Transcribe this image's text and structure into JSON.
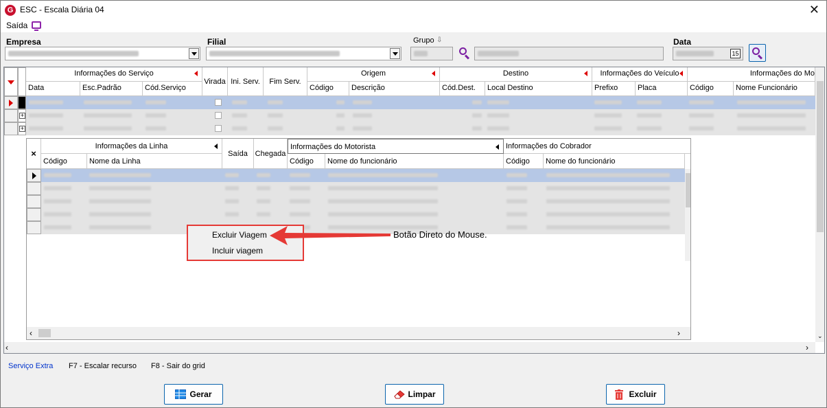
{
  "window": {
    "title": "ESC - Escala Diária 04",
    "logo_letter": "G"
  },
  "menu": {
    "saida": "Saída"
  },
  "filters": {
    "empresa_label": "Empresa",
    "filial_label": "Filial",
    "grupo_label": "Grupo",
    "grupo_sort_icon": "⇩",
    "data_label": "Data",
    "calendar_badge": "15"
  },
  "main_grid": {
    "group_headers": [
      "Informações do Serviço",
      "Virada",
      "Ini. Serv.",
      "Fim Serv.",
      "Origem",
      "Destino",
      "Informações do Veículo",
      "Informações do Mo"
    ],
    "columns": [
      "Data",
      "Esc.Padrão",
      "Cód.Serviço",
      "Código",
      "Descrição",
      "Cód.Dest.",
      "Local Destino",
      "Prefixo",
      "Placa",
      "Código",
      "Nome Funcionário"
    ]
  },
  "detail_grid": {
    "close_glyph": "×",
    "group_headers": [
      "Informações da Linha",
      "Saída",
      "Chegada",
      "Informações do Motorista",
      "Informações do Cobrador"
    ],
    "columns": [
      "Código",
      "Nome da Linha",
      "Código",
      "Nome do funcionário",
      "Código",
      "Nome do funcionário"
    ]
  },
  "context_menu": {
    "items": [
      "Excluir Viagem",
      "Incluir viagem"
    ]
  },
  "annotation": "Botão Direto do Mouse.",
  "status_bar": {
    "servico_extra": "Serviço Extra",
    "f7": "F7 - Escalar recurso",
    "f8": "F8 - Sair do grid"
  },
  "buttons": {
    "gerar": "Gerar",
    "limpar": "Limpar",
    "excluir": "Excluir"
  },
  "colors": {
    "accent": "#7b1fa2",
    "link": "#0033cc",
    "highlight_border": "#e53935",
    "selected_row": "#b6c8e6"
  }
}
